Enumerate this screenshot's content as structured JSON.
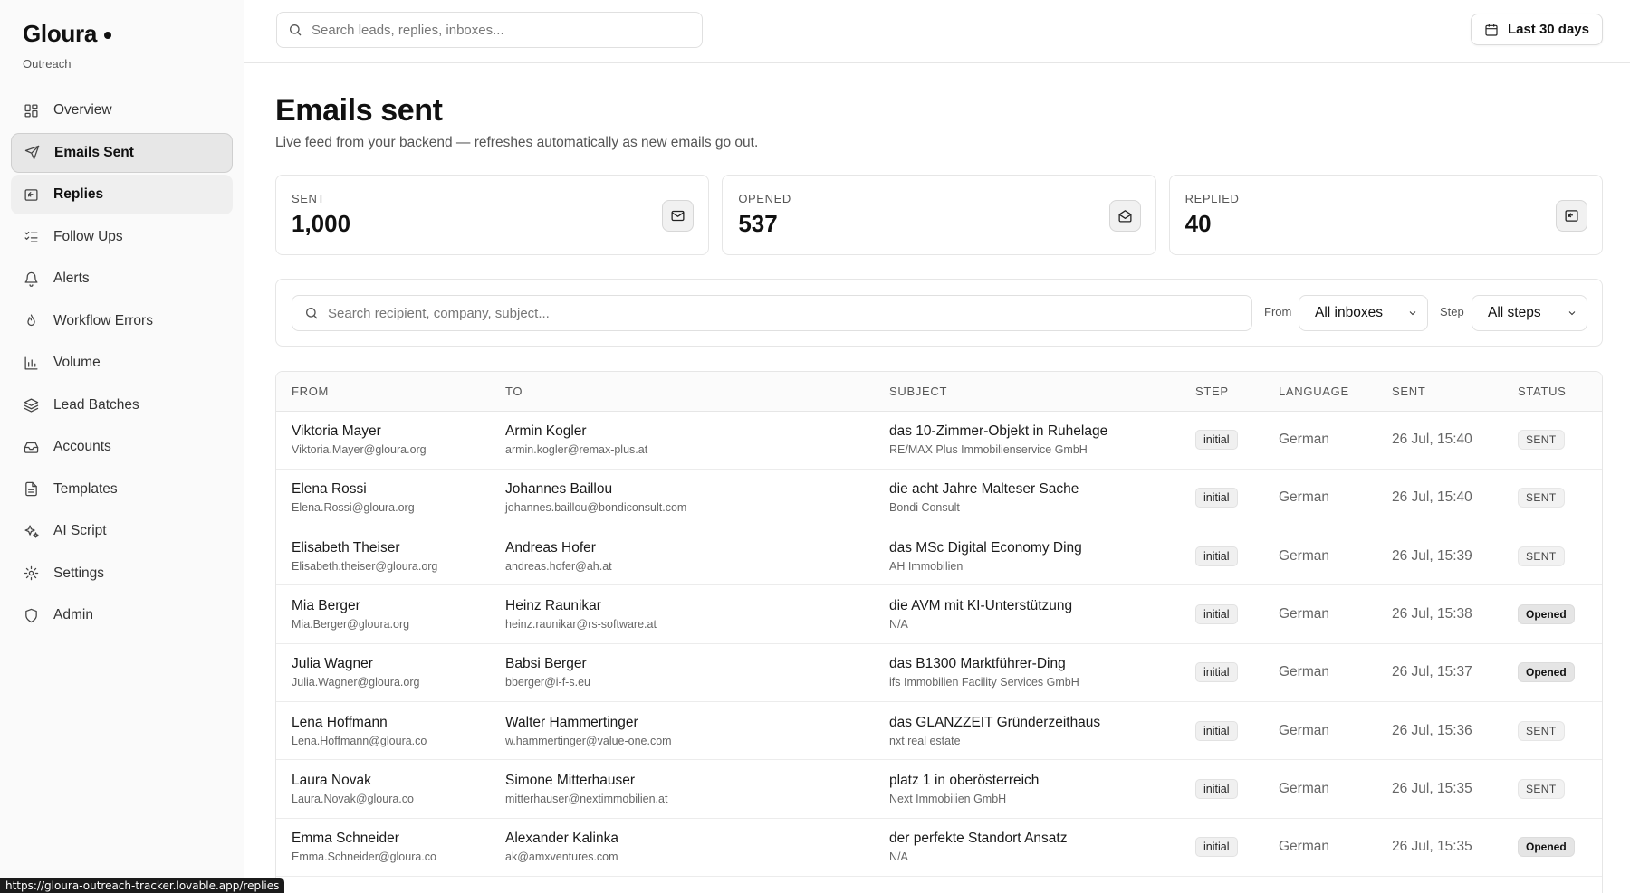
{
  "brand": {
    "name": "Gloura",
    "subtitle": "Outreach"
  },
  "sidebar": {
    "items": [
      {
        "label": "Overview",
        "icon": "layout-grid-icon",
        "state": ""
      },
      {
        "label": "Emails Sent",
        "icon": "send-icon",
        "state": "active"
      },
      {
        "label": "Replies",
        "icon": "reply-icon",
        "state": "hover"
      },
      {
        "label": "Follow Ups",
        "icon": "list-todo-icon",
        "state": ""
      },
      {
        "label": "Alerts",
        "icon": "bell-icon",
        "state": ""
      },
      {
        "label": "Workflow Errors",
        "icon": "flame-icon",
        "state": ""
      },
      {
        "label": "Volume",
        "icon": "bar-chart-icon",
        "state": ""
      },
      {
        "label": "Lead Batches",
        "icon": "layers-icon",
        "state": ""
      },
      {
        "label": "Accounts",
        "icon": "inbox-icon",
        "state": ""
      },
      {
        "label": "Templates",
        "icon": "file-text-icon",
        "state": ""
      },
      {
        "label": "AI Script",
        "icon": "sparkles-icon",
        "state": ""
      },
      {
        "label": "Settings",
        "icon": "gear-icon",
        "state": ""
      },
      {
        "label": "Admin",
        "icon": "shield-icon",
        "state": ""
      }
    ]
  },
  "topbar": {
    "search_placeholder": "Search leads, replies, inboxes...",
    "date_range_label": "Last 30 days"
  },
  "page": {
    "title": "Emails sent",
    "subtitle": "Live feed from your backend — refreshes automatically as new emails go out."
  },
  "stats": [
    {
      "label": "SENT",
      "value": "1,000",
      "icon": "mail-icon"
    },
    {
      "label": "OPENED",
      "value": "537",
      "icon": "mail-open-icon"
    },
    {
      "label": "REPLIED",
      "value": "40",
      "icon": "reply-icon"
    }
  ],
  "filters": {
    "search_placeholder": "Search recipient, company, subject...",
    "from_label": "From",
    "from_value": "All inboxes",
    "step_label": "Step",
    "step_value": "All steps"
  },
  "table": {
    "columns": [
      "FROM",
      "TO",
      "SUBJECT",
      "STEP",
      "LANGUAGE",
      "SENT",
      "STATUS"
    ],
    "rows": [
      {
        "from_name": "Viktoria Mayer",
        "from_email": "Viktoria.Mayer@gloura.org",
        "to_name": "Armin Kogler",
        "to_email": "armin.kogler@remax-plus.at",
        "subject": "das 10-Zimmer-Objekt in Ruhelage",
        "company": "RE/MAX Plus Immobilienservice GmbH",
        "step": "initial",
        "language": "German",
        "sent": "26 Jul, 15:40",
        "status": "SENT"
      },
      {
        "from_name": "Elena Rossi",
        "from_email": "Elena.Rossi@gloura.org",
        "to_name": "Johannes Baillou",
        "to_email": "johannes.baillou@bondiconsult.com",
        "subject": "die acht Jahre Malteser Sache",
        "company": "Bondi Consult",
        "step": "initial",
        "language": "German",
        "sent": "26 Jul, 15:40",
        "status": "SENT"
      },
      {
        "from_name": "Elisabeth Theiser",
        "from_email": "Elisabeth.theiser@gloura.org",
        "to_name": "Andreas Hofer",
        "to_email": "andreas.hofer@ah.at",
        "subject": "das MSc Digital Economy Ding",
        "company": "AH Immobilien",
        "step": "initial",
        "language": "German",
        "sent": "26 Jul, 15:39",
        "status": "SENT"
      },
      {
        "from_name": "Mia Berger",
        "from_email": "Mia.Berger@gloura.org",
        "to_name": "Heinz Raunikar",
        "to_email": "heinz.raunikar@rs-software.at",
        "subject": "die AVM mit KI-Unterstützung",
        "company": "N/A",
        "step": "initial",
        "language": "German",
        "sent": "26 Jul, 15:38",
        "status": "Opened"
      },
      {
        "from_name": "Julia Wagner",
        "from_email": "Julia.Wagner@gloura.org",
        "to_name": "Babsi Berger",
        "to_email": "bberger@i-f-s.eu",
        "subject": "das B1300 Marktführer-Ding",
        "company": "ifs Immobilien Facility Services GmbH",
        "step": "initial",
        "language": "German",
        "sent": "26 Jul, 15:37",
        "status": "Opened"
      },
      {
        "from_name": "Lena Hoffmann",
        "from_email": "Lena.Hoffmann@gloura.co",
        "to_name": "Walter Hammertinger",
        "to_email": "w.hammertinger@value-one.com",
        "subject": "das GLANZZEIT Gründerzeithaus",
        "company": "nxt real estate",
        "step": "initial",
        "language": "German",
        "sent": "26 Jul, 15:36",
        "status": "SENT"
      },
      {
        "from_name": "Laura Novak",
        "from_email": "Laura.Novak@gloura.co",
        "to_name": "Simone Mitterhauser",
        "to_email": "mitterhauser@nextimmobilien.at",
        "subject": "platz 1 in oberösterreich",
        "company": "Next Immobilien GmbH",
        "step": "initial",
        "language": "German",
        "sent": "26 Jul, 15:35",
        "status": "SENT"
      },
      {
        "from_name": "Emma Schneider",
        "from_email": "Emma.Schneider@gloura.co",
        "to_name": "Alexander Kalinka",
        "to_email": "ak@amxventures.com",
        "subject": "der perfekte Standort Ansatz",
        "company": "N/A",
        "step": "initial",
        "language": "German",
        "sent": "26 Jul, 15:35",
        "status": "Opened"
      }
    ]
  },
  "status_bar": {
    "url": "https://gloura-outreach-tracker.lovable.app/replies"
  }
}
